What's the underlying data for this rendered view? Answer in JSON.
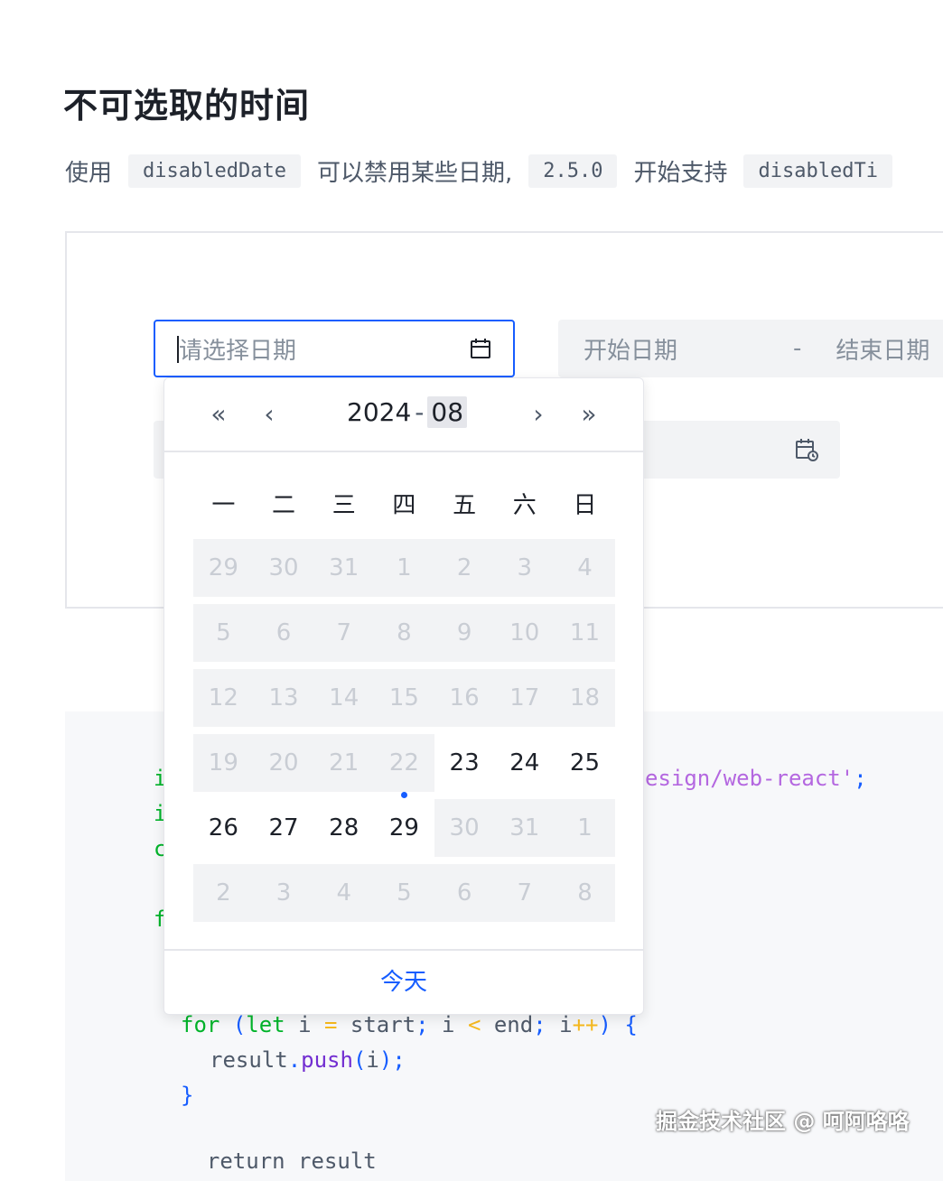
{
  "page": {
    "title": "不可选取的时间",
    "description": {
      "t1": "使用",
      "c1": "disabledDate",
      "t2": "可以禁用某些日期,",
      "c2": "2.5.0",
      "t3": "开始支持",
      "c3": "disabledTi"
    }
  },
  "demo": {
    "date_picker": {
      "placeholder": "请选择日期",
      "icon": "calendar-icon"
    },
    "range_picker": {
      "start_placeholder": "开始日期",
      "separator": "-",
      "end_placeholder": "结束日期"
    },
    "datetime_picker": {
      "icon": "calendar-clock-icon"
    }
  },
  "code": {
    "l1a": "i",
    "l1b": "esign/web-react'",
    "l1c": ";",
    "l2": "i",
    "l3": "c",
    "l4": "f",
    "l5_for": "for",
    "l5_lp": "(",
    "l5_let": "let",
    "l5_i": " i ",
    "l5_eq": "=",
    "l5_start": " start",
    "l5_sc": ";",
    "l5_i2": " i ",
    "l5_lt": "<",
    "l5_end": " end",
    "l5_sc2": ";",
    "l5_i3": " i",
    "l5_pp": "++",
    "l5_rp": ")",
    "l5_br": " {",
    "l6_result": "result",
    "l6_dot": ".",
    "l6_push": "push",
    "l6_lp": "(",
    "l6_i": "i",
    "l6_rp": ")",
    "l6_sc": ";",
    "l7": "}",
    "l8": "  return result"
  },
  "calendar": {
    "year": "2024",
    "separator": "-",
    "month": "08",
    "nav": {
      "prev_year": "«",
      "prev_month": "‹",
      "next_month": "›",
      "next_year": "»"
    },
    "weekdays": [
      "一",
      "二",
      "三",
      "四",
      "五",
      "六",
      "日"
    ],
    "weeks": [
      [
        "29",
        "30",
        "31",
        "1",
        "2",
        "3",
        "4"
      ],
      [
        "5",
        "6",
        "7",
        "8",
        "9",
        "10",
        "11"
      ],
      [
        "12",
        "13",
        "14",
        "15",
        "16",
        "17",
        "18"
      ],
      [
        "19",
        "20",
        "21",
        "22",
        "23",
        "24",
        "25"
      ],
      [
        "26",
        "27",
        "28",
        "29",
        "30",
        "31",
        "1"
      ],
      [
        "2",
        "3",
        "4",
        "5",
        "6",
        "7",
        "8"
      ]
    ],
    "today_label": "今天"
  },
  "watermark": "掘金技术社区 @ 呵阿咯咯",
  "colors": {
    "primary": "#165dff",
    "disabled_bg": "#f2f3f5",
    "disabled_text": "#c9cdd4"
  }
}
